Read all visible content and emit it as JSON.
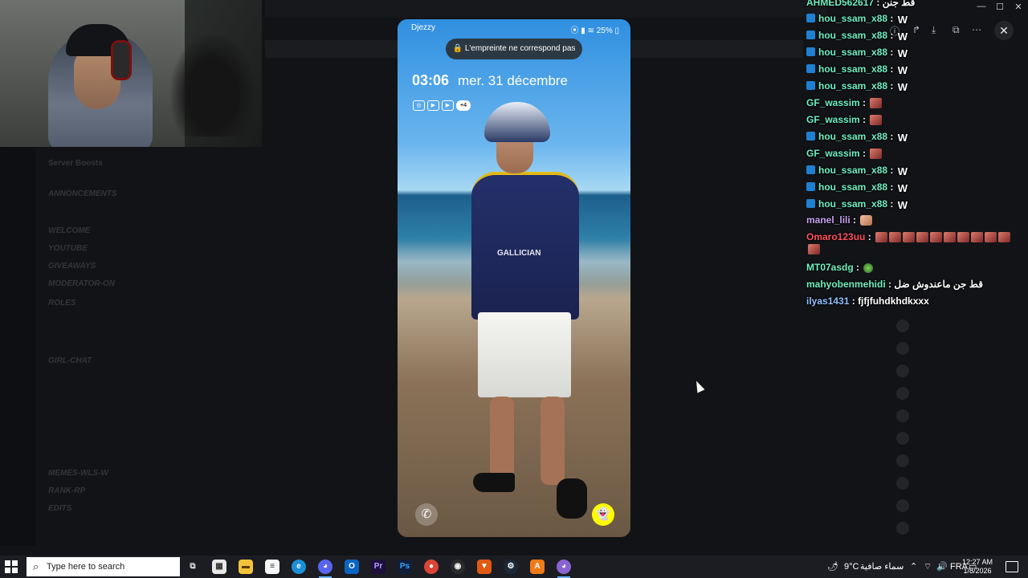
{
  "phone": {
    "carrier": "Djezzy",
    "battery": "25%",
    "toast": "L'empreinte ne correspond pas",
    "time": "03:06",
    "date": "mer. 31 décembre",
    "notif_more": "+4",
    "shirt_text": "GALLICIAN"
  },
  "background": {
    "channels": [
      "Server Boosts",
      "ANNONCEMENTS",
      "WELCOME",
      "YOUTUBE",
      "GIVEAWAYS",
      "MODERATOR-ON",
      "ROLES",
      "GIRL-CHAT",
      "MEMES-WLS-W",
      "RANK-RP",
      "EDITS"
    ]
  },
  "chat": {
    "messages": [
      {
        "user": "AHMED562617",
        "msg": "قط جنن",
        "color": "mint",
        "badge": false,
        "emote": ""
      },
      {
        "user": "hou_ssam_x88",
        "msg": "",
        "color": "mint",
        "badge": true,
        "emote": "W"
      },
      {
        "user": "hou_ssam_x88",
        "msg": "",
        "color": "mint",
        "badge": true,
        "emote": "W"
      },
      {
        "user": "hou_ssam_x88",
        "msg": "",
        "color": "mint",
        "badge": true,
        "emote": "W"
      },
      {
        "user": "hou_ssam_x88",
        "msg": "",
        "color": "mint",
        "badge": true,
        "emote": "W"
      },
      {
        "user": "hou_ssam_x88",
        "msg": "",
        "color": "mint",
        "badge": true,
        "emote": "W"
      },
      {
        "user": "GF_wassim",
        "msg": "",
        "color": "mint",
        "badge": false,
        "emote": "face"
      },
      {
        "user": "GF_wassim",
        "msg": "",
        "color": "mint",
        "badge": false,
        "emote": "face"
      },
      {
        "user": "hou_ssam_x88",
        "msg": "",
        "color": "mint",
        "badge": true,
        "emote": "W"
      },
      {
        "user": "GF_wassim",
        "msg": "",
        "color": "mint",
        "badge": false,
        "emote": "face"
      },
      {
        "user": "hou_ssam_x88",
        "msg": "",
        "color": "mint",
        "badge": true,
        "emote": "W"
      },
      {
        "user": "hou_ssam_x88",
        "msg": "",
        "color": "mint",
        "badge": true,
        "emote": "W"
      },
      {
        "user": "hou_ssam_x88",
        "msg": "",
        "color": "mint",
        "badge": true,
        "emote": "W"
      },
      {
        "user": "manel_lili",
        "msg": "",
        "color": "purple",
        "badge": false,
        "emote": "cat"
      },
      {
        "user": "Omaro123uu",
        "msg": "",
        "color": "red",
        "badge": false,
        "emote": "face-row"
      },
      {
        "user": "MT07asdg",
        "msg": "",
        "color": "mint",
        "badge": false,
        "emote": "green"
      },
      {
        "user": "mahyobenmehidi",
        "msg": "قط جن ماعندوش ضل",
        "color": "mint",
        "badge": false,
        "emote": ""
      },
      {
        "user": "ilyas1431",
        "msg": "fjfjfuhdkhdkxxx",
        "color": "blue",
        "badge": false,
        "emote": ""
      }
    ]
  },
  "taskbar": {
    "search_placeholder": "Type here to search",
    "weather_temp": "9°C",
    "weather_desc": "سماء صافية",
    "language": "FRA",
    "time": "12:27 AM",
    "date": "1/8/2026"
  },
  "colors": {
    "mint": "#6ef0c2",
    "purple": "#c7a2f0",
    "red": "#ff4f5c",
    "blue": "#8fc0ff",
    "snapchat": "#fffc00"
  }
}
